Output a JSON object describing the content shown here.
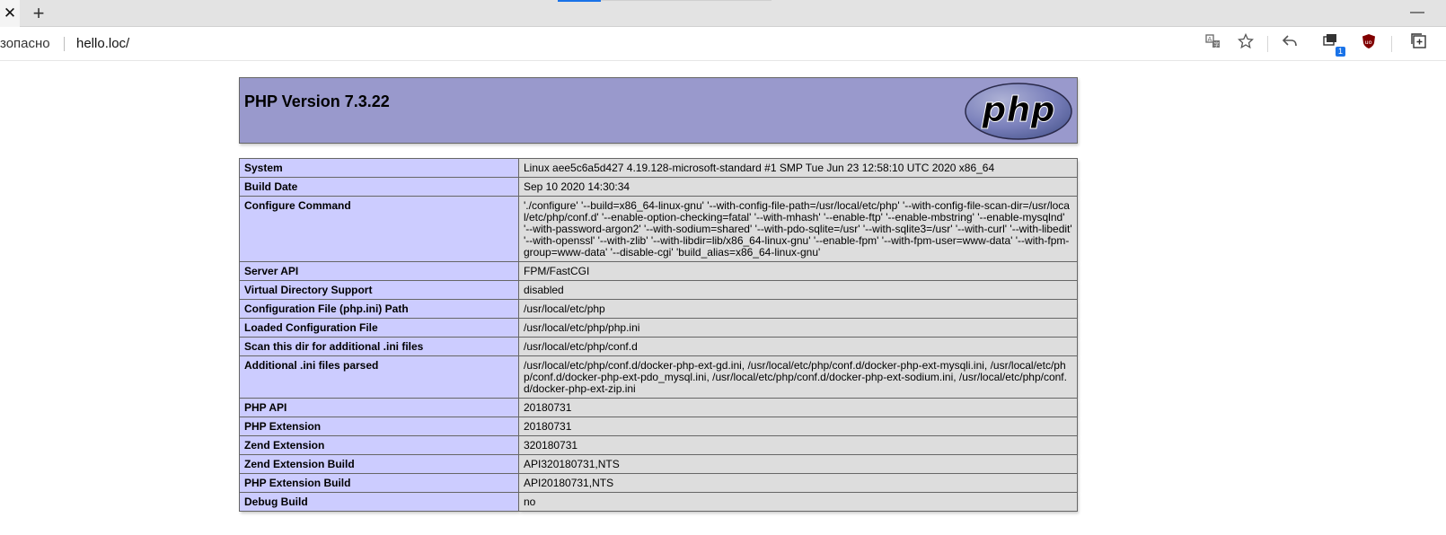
{
  "browser": {
    "tab_close_glyph": "✕",
    "new_tab_glyph": "+",
    "minimize_glyph": "—",
    "accent_color": "#1a73e8",
    "security_text": "зопасно",
    "url": "hello.loc/",
    "toolbar": {
      "translate_icon": "translate-icon",
      "favorite_icon": "star-icon",
      "share_icon": "share-icon",
      "collections_icon": "collections-icon",
      "collections_badge": "1",
      "ublock_icon": "ublock-icon",
      "ublock_label": "uo",
      "new_window_icon": "new-window-icon"
    }
  },
  "php": {
    "header_bg": "#9999cc",
    "label_bg": "#ccccff",
    "value_bg": "#dddddd",
    "title": "PHP Version 7.3.22",
    "logo_text": "php",
    "rows": [
      {
        "key": "System",
        "value": "Linux aee5c6a5d427 4.19.128-microsoft-standard #1 SMP Tue Jun 23 12:58:10 UTC 2020 x86_64"
      },
      {
        "key": "Build Date",
        "value": "Sep 10 2020 14:30:34"
      },
      {
        "key": "Configure Command",
        "value": "'./configure' '--build=x86_64-linux-gnu' '--with-config-file-path=/usr/local/etc/php' '--with-config-file-scan-dir=/usr/local/etc/php/conf.d' '--enable-option-checking=fatal' '--with-mhash' '--enable-ftp' '--enable-mbstring' '--enable-mysqlnd' '--with-password-argon2' '--with-sodium=shared' '--with-pdo-sqlite=/usr' '--with-sqlite3=/usr' '--with-curl' '--with-libedit' '--with-openssl' '--with-zlib' '--with-libdir=lib/x86_64-linux-gnu' '--enable-fpm' '--with-fpm-user=www-data' '--with-fpm-group=www-data' '--disable-cgi' 'build_alias=x86_64-linux-gnu'"
      },
      {
        "key": "Server API",
        "value": "FPM/FastCGI"
      },
      {
        "key": "Virtual Directory Support",
        "value": "disabled"
      },
      {
        "key": "Configuration File (php.ini) Path",
        "value": "/usr/local/etc/php"
      },
      {
        "key": "Loaded Configuration File",
        "value": "/usr/local/etc/php/php.ini"
      },
      {
        "key": "Scan this dir for additional .ini files",
        "value": "/usr/local/etc/php/conf.d"
      },
      {
        "key": "Additional .ini files parsed",
        "value": "/usr/local/etc/php/conf.d/docker-php-ext-gd.ini, /usr/local/etc/php/conf.d/docker-php-ext-mysqli.ini, /usr/local/etc/php/conf.d/docker-php-ext-pdo_mysql.ini, /usr/local/etc/php/conf.d/docker-php-ext-sodium.ini, /usr/local/etc/php/conf.d/docker-php-ext-zip.ini"
      },
      {
        "key": "PHP API",
        "value": "20180731"
      },
      {
        "key": "PHP Extension",
        "value": "20180731"
      },
      {
        "key": "Zend Extension",
        "value": "320180731"
      },
      {
        "key": "Zend Extension Build",
        "value": "API320180731,NTS"
      },
      {
        "key": "PHP Extension Build",
        "value": "API20180731,NTS"
      },
      {
        "key": "Debug Build",
        "value": "no"
      }
    ]
  }
}
